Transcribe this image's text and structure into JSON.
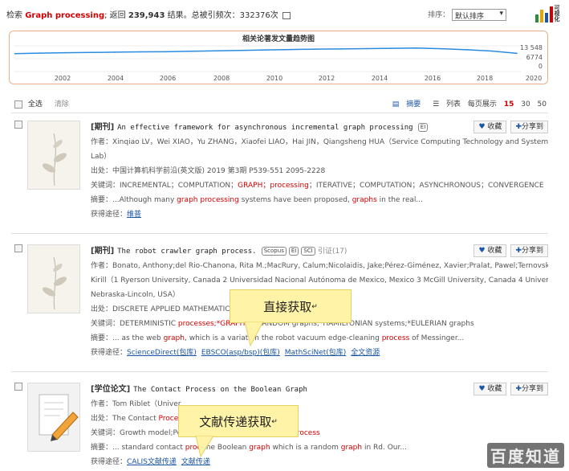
{
  "summary": {
    "prefix": "检索",
    "query": "Graph processing",
    "return_label": "; 返回",
    "count": "239,943",
    "result_label": "结果。总被引频次：",
    "citations": "332376次"
  },
  "sort": {
    "label": "排序：",
    "selected": "默认排序",
    "viz_label": "可视化"
  },
  "trend": {
    "title": "相关论著发文量趋势图",
    "y_ticks": [
      "13 548",
      "6774",
      "0"
    ],
    "x_ticks": [
      "2002",
      "2004",
      "2006",
      "2008",
      "2010",
      "2012",
      "2014",
      "2016",
      "2018",
      "2020"
    ]
  },
  "chart_data": {
    "type": "line",
    "title": "相关论著发文量趋势图",
    "x": [
      2000,
      2001,
      2002,
      2003,
      2004,
      2005,
      2006,
      2007,
      2008,
      2009,
      2010,
      2011,
      2012,
      2013,
      2014,
      2015,
      2016,
      2017,
      2018,
      2019,
      2020
    ],
    "values": [
      9400,
      9700,
      9900,
      10050,
      10200,
      10350,
      10400,
      10700,
      10900,
      11100,
      11400,
      11600,
      11800,
      11900,
      12050,
      12250,
      12400,
      12000,
      11500,
      10800,
      9600
    ],
    "ylim": [
      0,
      13548
    ],
    "y_ticks": [
      0,
      6774,
      13548
    ],
    "xlabel": "",
    "ylabel": ""
  },
  "controls": {
    "select_all": "全选",
    "clear": "清除",
    "abstract": "摘要",
    "list": "列表",
    "per_page_label": "每页展示",
    "per_page": [
      "15",
      "30",
      "50"
    ]
  },
  "buttons": {
    "favorite": "收藏",
    "share": "分享到"
  },
  "records": [
    {
      "type": "[期刊]",
      "title_pre": "An effective framework for asynchronous incremental ",
      "title_hl": "graph processing",
      "tags": [
        "EI"
      ],
      "cite": "",
      "authors": "作者：Xinqiao LV，Wei XIAO，Yu ZHANG，Xiaofei LIAO，Hai JIN，Qiangsheng HUA（Service Computing Technology and System",
      "authors2": "Lab）",
      "source": "出处：中国计算机科学前沿(英文版) 2019 第3期 P539-551  2095-2228",
      "keywords_pre": "关键词：INCREMENTAL；COMPUTATION；",
      "keywords_hl": "GRAPH；processing",
      "keywords_post": "；ITERATIVE；COMPUTATION；ASYNCHRONOUS；CONVERGENCE",
      "abstract_pre": "摘要：...Although many ",
      "abstract_hl": "graph processing",
      "abstract_mid": " systems have been proposed, ",
      "abstract_hl2": "graphs",
      "abstract_post": " in the real...",
      "access_label": "获得途径：",
      "links": [
        "维普"
      ]
    },
    {
      "type": "[期刊]",
      "title_pre": "The robot crawler ",
      "title_hl": "graph process.",
      "tags": [
        "Scopus",
        "EI",
        "SCI"
      ],
      "cite": "引证(17)",
      "authors": "作者：Bonato, Anthony;del Rio-Chanona, Rita M.;MacRury, Calum;Nicolaidis, Jake;Pérez-Giménez, Xavier;Pralat, Pawel;Ternovsky,",
      "authors2": "Kirill（1 Ryerson University, Canada 2 Universidad Nacional Autónoma de Mexico, Mexico 3 McGill University, Canada 4 University of",
      "authors3": "Nebraska-Lincoln, USA）",
      "source": "出处：DISCRETE APPLIED MATHEMATICS",
      "keywords_pre": "关键词：DETERMINISTIC ",
      "keywords_hl": "processes;*GRAPH",
      "keywords_post": " th     RANDOM graphs;*HAMILTONIAN systems;*EULERIAN graphs",
      "abstract_pre": "摘要：... as the web ",
      "abstract_hl": "graph",
      "abstract_mid": ", which is a variation     the robot vacuum edge-cleaning ",
      "abstract_hl2": "process",
      "abstract_post": " of Messinger...",
      "access_label": "获得途径：",
      "links": [
        "ScienceDirect(包库)",
        "EBSCO(asp/bsp)(包库)",
        "MathSciNet(包库)",
        "全文资源"
      ]
    },
    {
      "type": "[学位论文]",
      "title_pre": "The Contact ",
      "title_hl": "Process",
      "title_mid": " on the Boolean ",
      "title_hl2": "Graph",
      "authors": "作者：Tom Riblet（Univer",
      "source_pre": "出处：The Contact ",
      "source_hl": "Proces",
      "keywords_pre": "关键词：Growth model;Percolati",
      "keywords_hl": "process",
      "abstract_pre": "摘要：... standard contact ",
      "abstract_hl": "proc",
      "abstract_mid": "     the Boolean ",
      "abstract_hl2": "graph",
      "abstract_mid2": " which is a random ",
      "abstract_hl3": "graph",
      "abstract_post": " in Rd. Our...",
      "access_label": "获得途径：",
      "links": [
        "CALIS文献传递",
        "文献传递"
      ]
    }
  ],
  "callouts": [
    "直接获取",
    "文献传递获取"
  ],
  "callout_mark": "↵",
  "watermark": "百度知道"
}
